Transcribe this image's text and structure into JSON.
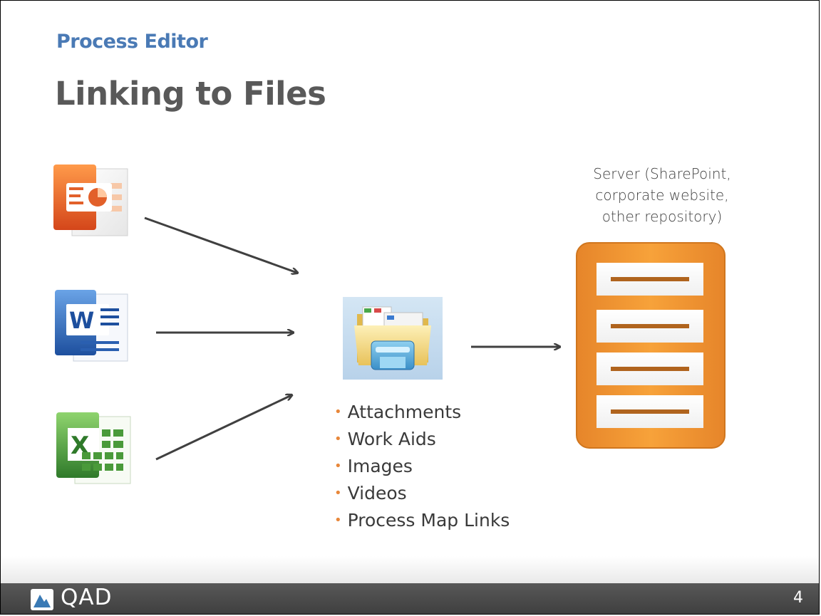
{
  "header": {
    "section": "Process Editor",
    "title": "Linking to Files"
  },
  "sources": {
    "icons": [
      "powerpoint-icon",
      "word-icon",
      "excel-icon"
    ]
  },
  "hub": {
    "icon": "folder-icon",
    "items": [
      "Attachments",
      "Work Aids",
      "Images",
      "Videos",
      "Process Map Links"
    ]
  },
  "server": {
    "label_lines": [
      "Server  (SharePoint,",
      "corporate website,",
      "other repository)"
    ],
    "icon": "server-icon"
  },
  "footer": {
    "logo_text": "QAD",
    "page_number": "4"
  },
  "colors": {
    "section_title": "#4a7ab5",
    "title": "#595959",
    "bullet": "#e8873a",
    "server_orange": "#f39b2b",
    "footer_bg": "#4a4a4a"
  }
}
